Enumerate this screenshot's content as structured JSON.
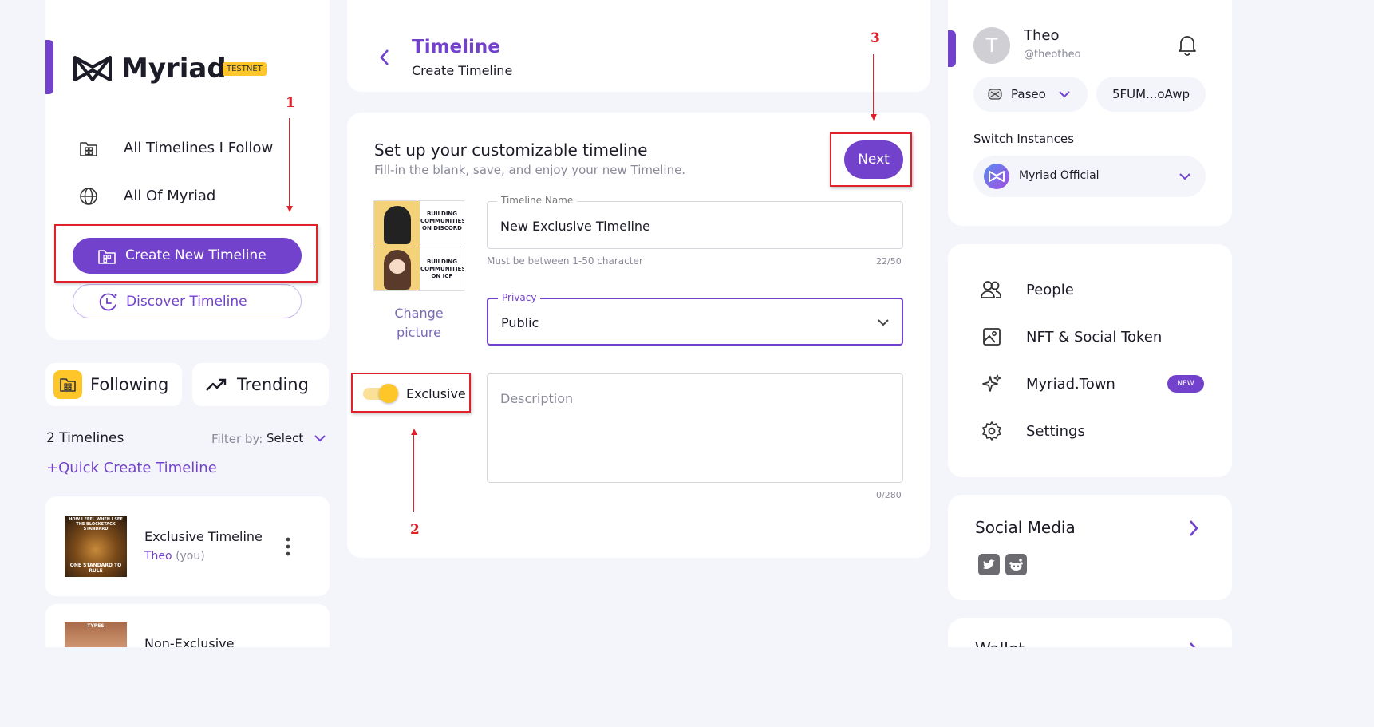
{
  "brand": {
    "name": "Myriad",
    "badge": "TESTNET"
  },
  "left_nav": {
    "items": [
      {
        "label": "All Timelines I Follow",
        "icon": "folder-grid-icon"
      },
      {
        "label": "All Of Myriad",
        "icon": "globe-icon"
      }
    ],
    "create_button": "Create New Timeline",
    "discover_button": "Discover Timeline"
  },
  "left_tabs": {
    "following": "Following",
    "trending": "Trending"
  },
  "timeline_list": {
    "count_label": "2 Timelines",
    "filter_label": "Filter by:",
    "filter_value": "Select",
    "quick_create": "+Quick Create Timeline",
    "items": [
      {
        "title": "Exclusive Timeline",
        "owner": "Theo",
        "owner_suffix": "(you)",
        "thumb_top": "HOW I FEEL WHEN I SEE THE BLOCKSTACK STANDARD",
        "thumb_bottom": "ONE STANDARD TO RULE"
      },
      {
        "title": "Non-Exclusive",
        "thumb_top": "TYPES"
      }
    ]
  },
  "header": {
    "title": "Timeline",
    "subtitle": "Create Timeline"
  },
  "form": {
    "heading": "Set up your customizable timeline",
    "subheading": "Fill-in the blank, save, and enjoy your new Timeline.",
    "next_button": "Next",
    "change_picture": "Change picture",
    "picture_caption_top": "BUILDING COMMUNITIES ON DISCORD",
    "picture_caption_bottom": "BUILDING COMMUNITIES ON ICP",
    "name_label": "Timeline Name",
    "name_value": "New Exclusive Timeline",
    "name_hint": "Must be between 1-50 character",
    "name_counter": "22/50",
    "privacy_label": "Privacy",
    "privacy_value": "Public",
    "exclusive_label": "Exclusive",
    "exclusive_on": true,
    "description_placeholder": "Description",
    "description_counter": "0/280"
  },
  "annotations": [
    "1",
    "2",
    "3"
  ],
  "profile": {
    "avatar_initial": "T",
    "name": "Theo",
    "handle": "@theotheo",
    "network": "Paseo",
    "address": "5FUM...oAwp",
    "switch_label": "Switch Instances",
    "instance": "Myriad Official"
  },
  "right_menu": [
    {
      "label": "People",
      "icon": "people-icon"
    },
    {
      "label": "NFT & Social Token",
      "icon": "image-icon"
    },
    {
      "label": "Myriad.Town",
      "icon": "sparkle-icon",
      "badge": "NEW"
    },
    {
      "label": "Settings",
      "icon": "gear-icon"
    }
  ],
  "social": {
    "title": "Social Media",
    "networks": [
      "twitter-icon",
      "reddit-icon"
    ]
  },
  "wallet": {
    "title": "Wallet"
  },
  "colors": {
    "accent": "#7342cc",
    "badge": "#ffc629",
    "annotation": "#e0202a"
  }
}
